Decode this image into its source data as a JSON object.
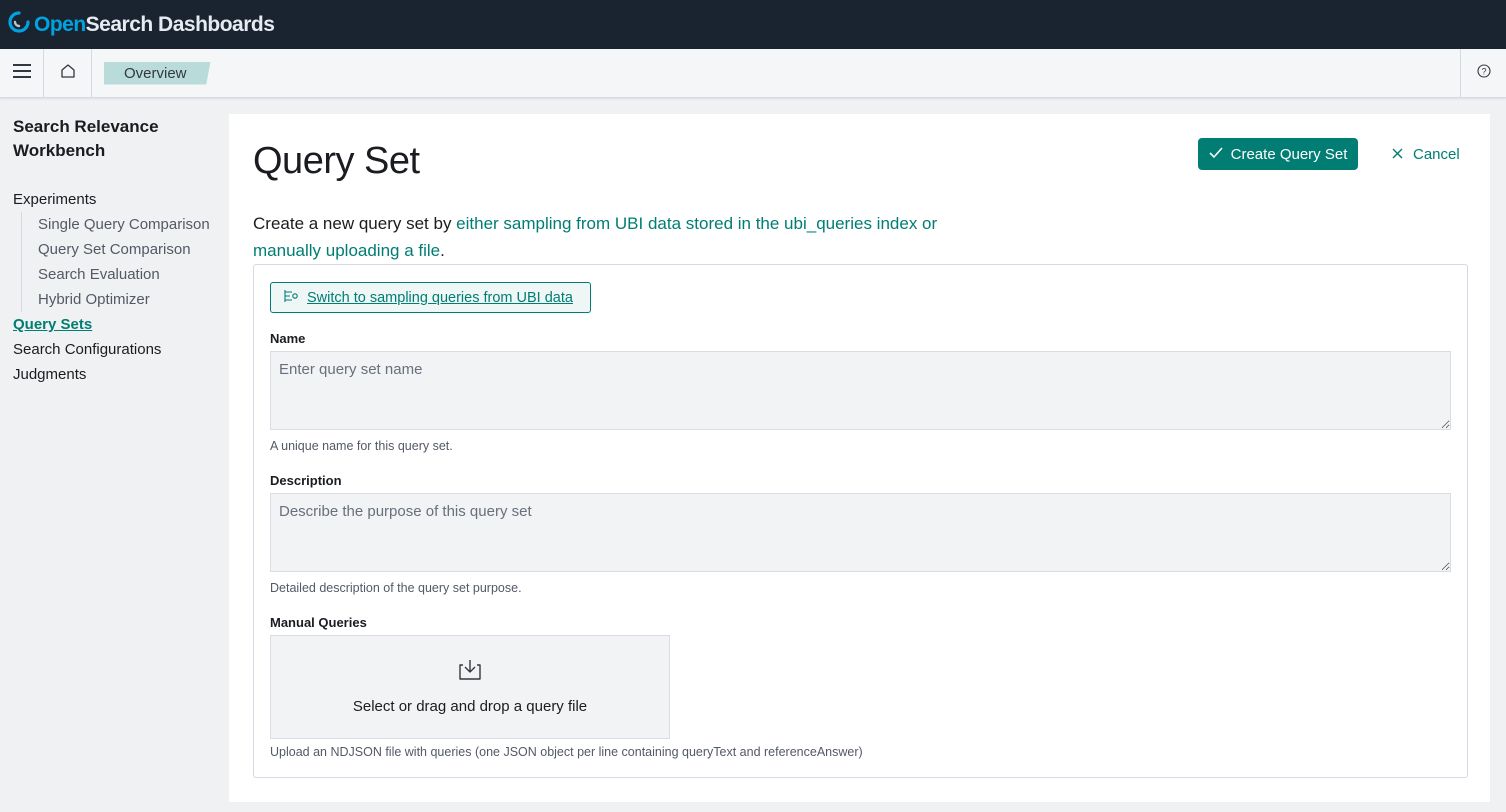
{
  "header": {
    "logo_open": "Open",
    "logo_rest": "Search Dashboards"
  },
  "breadcrumbs": [
    "Overview"
  ],
  "sidebar": {
    "title": "Search Relevance Workbench",
    "items": [
      {
        "label": "Experiments",
        "level": 0,
        "active": false
      },
      {
        "label": "Single Query Comparison",
        "level": 1,
        "active": false
      },
      {
        "label": "Query Set Comparison",
        "level": 1,
        "active": false
      },
      {
        "label": "Search Evaluation",
        "level": 1,
        "active": false
      },
      {
        "label": "Hybrid Optimizer",
        "level": 1,
        "active": false
      },
      {
        "label": "Query Sets",
        "level": 0,
        "active": true
      },
      {
        "label": "Search Configurations",
        "level": 0,
        "active": false
      },
      {
        "label": "Judgments",
        "level": 0,
        "active": false
      }
    ]
  },
  "main": {
    "title": "Query Set",
    "create_label": "Create Query Set",
    "cancel_label": "Cancel",
    "intro_prefix": "Create a new query set by ",
    "intro_link": "either sampling from UBI data stored in the ubi_queries index or manually uploading a file",
    "intro_suffix": ".",
    "switch_label": "Switch to sampling queries from UBI data",
    "name": {
      "label": "Name",
      "placeholder": "Enter query set name",
      "value": "",
      "help": "A unique name for this query set."
    },
    "description": {
      "label": "Description",
      "placeholder": "Describe the purpose of this query set",
      "value": "",
      "help": "Detailed description of the query set purpose."
    },
    "manual": {
      "label": "Manual Queries",
      "dropzone_text": "Select or drag and drop a query file",
      "help": "Upload an NDJSON file with queries (one JSON object per line containing queryText and referenceAnswer)"
    }
  },
  "colors": {
    "header_bg": "#1a2430",
    "accent": "#017d73",
    "crumb_bg": "#b9dcdb",
    "page_bg": "#f0f1f2"
  },
  "icons": [
    "opensearch-logo-icon",
    "hamburger-menu-icon",
    "home-icon",
    "help-icon",
    "check-icon",
    "close-icon",
    "branch-icon",
    "download-tray-icon"
  ]
}
